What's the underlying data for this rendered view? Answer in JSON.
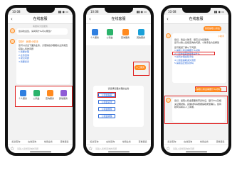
{
  "statusbar": {
    "time": "10:08",
    "signal": "▮▮ ◉ ▭"
  },
  "header": {
    "title": "在线客服",
    "back": "‹"
  },
  "quick_bar": [
    "投资查询",
    "在线咨询",
    "常用业务",
    "查看更多"
  ],
  "input": {
    "placeholder": "请输入您想咨询的问题"
  },
  "phone1": {
    "subtitle": "客服将为您服务",
    "welcome": "您好欢迎您，请问有什么可以帮您?",
    "card_text": "您可以点击下面的业务，方便快捷办理相关业务或直接输入您的问题",
    "card_options": [
      "1.我要办理",
      "2.业务咨询",
      "3.常见问题",
      "4.我要投诉"
    ],
    "card_note": "您好！我是小助手",
    "services": [
      {
        "label": "个人服务",
        "color": "#2f7fe0"
      },
      {
        "label": "公积金",
        "color": "#2bb36b"
      },
      {
        "label": "查询服务",
        "color": "#ff8a1f"
      },
      {
        "label": "其他服务",
        "color": "#8f5bd6"
      }
    ]
  },
  "phone2": {
    "services": [
      {
        "label": "个人服务",
        "color": "#2f7fe0"
      },
      {
        "label": "公积金",
        "color": "#2bb36b"
      },
      {
        "label": "查询服务",
        "color": "#ff8a1f"
      },
      {
        "label": "其他服务",
        "color": "#1aa0d8"
      }
    ],
    "orange_label": "人工服务",
    "prompt": "请选择您要办理的业务",
    "options": [
      "公积金提取",
      "公积金贷款",
      "公积金缴存",
      "公积金转移"
    ]
  },
  "phone3": {
    "user_bubble": "我想提取公积金",
    "greeting_name": "小助手",
    "greeting": "您好，我是小助手，很高兴为您服务！",
    "intro": "您可以输入您想咨询的问题，小助手会为您解答",
    "link_intro": "您可能想了解以下问题：",
    "links": [
      "1.提取公积金需要什么材料",
      "2.公积金提取的条件是什么",
      "3.如何办理提取手续",
      "4.公积金提取多久到账",
      "5.提取后还能贷款吗"
    ],
    "user_bubble2": "提取公积金需要什么材料",
    "answer": "您好，提取公积金需要携带身份证、银行卡以及相关证明材料，具体材料请根据提取类型确认。如有疑问请联系人工客服。"
  }
}
